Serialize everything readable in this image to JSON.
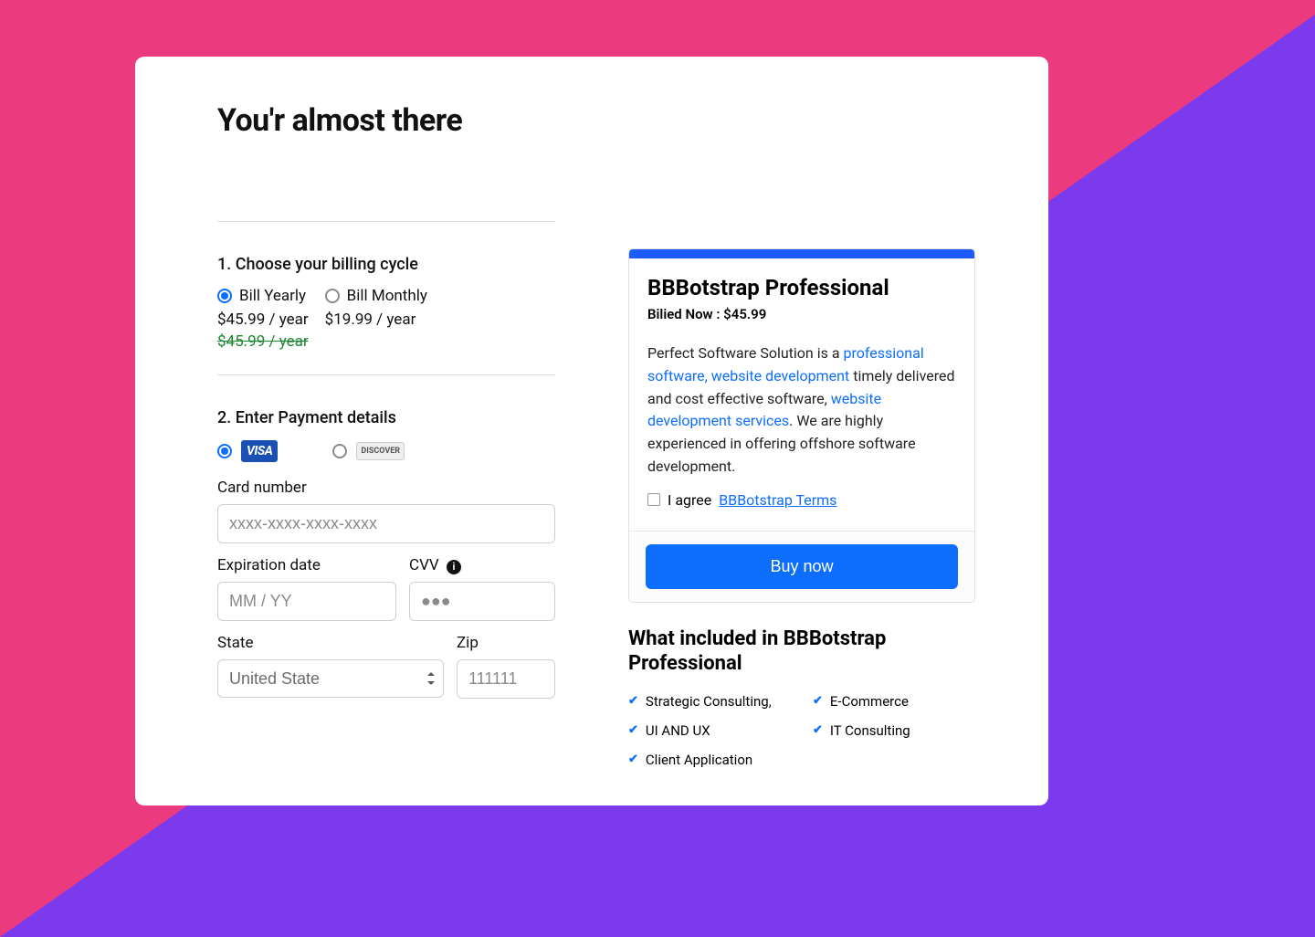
{
  "page": {
    "title": "You'r almost there"
  },
  "billing": {
    "step_title": "1. Choose your billing cycle",
    "yearly": {
      "label": "Bill Yearly",
      "price": "$45.99 / year",
      "strike_price": "$45.99 / year"
    },
    "monthly": {
      "label": "Bill Monthly",
      "price": "$19.99 / year"
    }
  },
  "payment": {
    "step_title": "2. Enter Payment details",
    "visa_label": "VISA",
    "discover_label": "DISCOVER",
    "card_number_label": "Card number",
    "card_number_placeholder": "xxxx-xxxx-xxxx-xxxx",
    "exp_label": "Expiration date",
    "exp_placeholder": "MM / YY",
    "cvv_label": "CVV",
    "cvv_placeholder": "●●●",
    "state_label": "State",
    "state_value": "United State",
    "zip_label": "Zip",
    "zip_placeholder": "111111"
  },
  "summary": {
    "title": "BBBotstrap Professional",
    "billed_now": "Bilied Now : $45.99",
    "desc_part1": "Perfect Software Solution is a ",
    "link1": "professional software, website development",
    "desc_part2": " timely delivered and cost effective software, ",
    "link2": "website development services",
    "desc_part3": ". We are highly experienced in offering offshore software development.",
    "agree_text": "I agree ",
    "terms_link": "BBBotstrap Terms",
    "buy_button": "Buy now"
  },
  "included": {
    "title": "What included in BBBotstrap Professional",
    "features": {
      "f0": "Strategic Consulting,",
      "f1": "E-Commerce",
      "f2": "UI AND UX",
      "f3": "IT Consulting",
      "f4": "Client Application"
    }
  }
}
